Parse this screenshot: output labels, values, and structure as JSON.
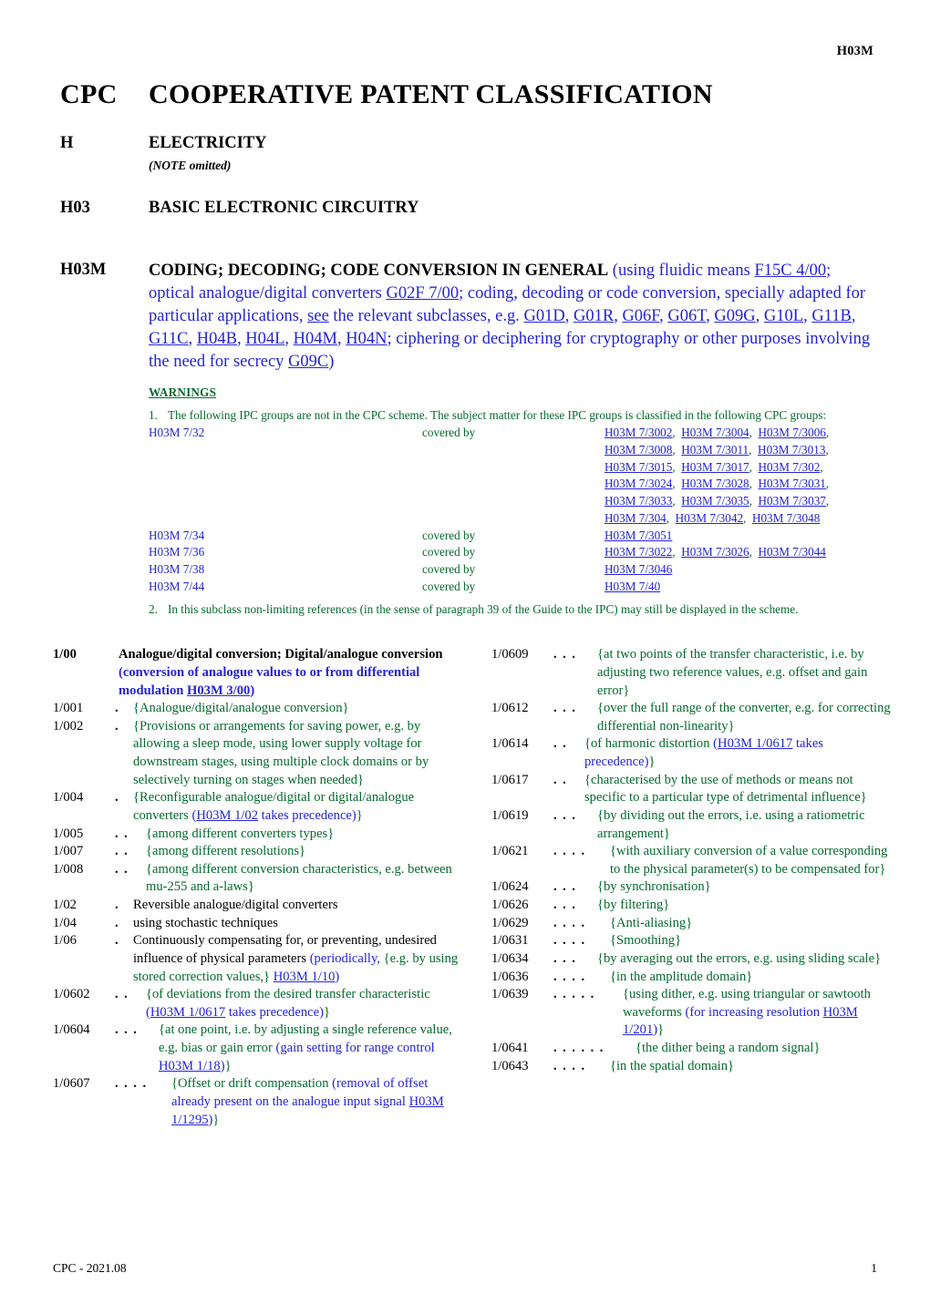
{
  "header": {
    "running_head": "H03M"
  },
  "titles": {
    "cpc_code": "CPC",
    "cpc_title": "COOPERATIVE PATENT CLASSIFICATION",
    "section_code": "H",
    "section_title": "ELECTRICITY",
    "note_omitted": "(NOTE omitted)",
    "class_code": "H03",
    "class_title": "BASIC ELECTRONIC CIRCUITRY"
  },
  "subclass": {
    "code": "H03M",
    "title": "CODING; DECODING; CODE CONVERSION IN GENERAL",
    "note_parts": [
      {
        "t": " (using fluidic means ",
        "style": "blue"
      },
      {
        "t": "F15C 4/00",
        "style": "link"
      },
      {
        "t": "; optical analogue/digital converters ",
        "style": "blue"
      },
      {
        "t": "G02F 7/00",
        "style": "link"
      },
      {
        "t": "; coding, decoding or code conversion, specially adapted for particular applications, ",
        "style": "blue"
      },
      {
        "t": "see",
        "style": "link"
      },
      {
        "t": " the relevant subclasses, e.g. ",
        "style": "blue"
      },
      {
        "t": "G01D",
        "style": "link"
      },
      {
        "t": ", ",
        "style": "blue"
      },
      {
        "t": "G01R",
        "style": "link"
      },
      {
        "t": ", ",
        "style": "blue"
      },
      {
        "t": "G06F",
        "style": "link"
      },
      {
        "t": ", ",
        "style": "blue"
      },
      {
        "t": "G06T",
        "style": "link"
      },
      {
        "t": ", ",
        "style": "blue"
      },
      {
        "t": "G09G",
        "style": "link"
      },
      {
        "t": ", ",
        "style": "blue"
      },
      {
        "t": "G10L",
        "style": "link"
      },
      {
        "t": ", ",
        "style": "blue"
      },
      {
        "t": "G11B",
        "style": "link"
      },
      {
        "t": ", ",
        "style": "blue"
      },
      {
        "t": "G11C",
        "style": "link"
      },
      {
        "t": ", ",
        "style": "blue"
      },
      {
        "t": "H04B",
        "style": "link"
      },
      {
        "t": ", ",
        "style": "blue"
      },
      {
        "t": "H04L",
        "style": "link"
      },
      {
        "t": ", ",
        "style": "blue"
      },
      {
        "t": "H04M",
        "style": "link"
      },
      {
        "t": ", ",
        "style": "blue"
      },
      {
        "t": "H04N",
        "style": "link"
      },
      {
        "t": "; ciphering or deciphering for cryptography or other purposes involving the need for secrecy ",
        "style": "blue"
      },
      {
        "t": "G09C",
        "style": "link"
      },
      {
        "t": ")",
        "style": "blue"
      }
    ]
  },
  "warnings": {
    "heading": "WARNINGS",
    "item1_number": "1.",
    "item1_text": "The following IPC groups are not in the CPC scheme. The subject matter for these IPC groups is classified in the following CPC groups:",
    "covered_by_label": "covered by",
    "rows": [
      {
        "ipc": "H03M 7/32",
        "covered": "covered by",
        "targets": [
          [
            "H03M 7/3002",
            "H03M 7/3004",
            "H03M 7/3006"
          ],
          [
            "H03M 7/3008",
            "H03M 7/3011",
            "H03M 7/3013"
          ],
          [
            "H03M 7/3015",
            "H03M 7/3017",
            "H03M 7/302"
          ],
          [
            "H03M 7/3024",
            "H03M 7/3028",
            "H03M 7/3031"
          ],
          [
            "H03M 7/3033",
            "H03M 7/3035",
            "H03M 7/3037"
          ],
          [
            "H03M 7/304",
            "H03M 7/3042",
            "H03M 7/3048"
          ]
        ]
      },
      {
        "ipc": "H03M 7/34",
        "covered": "covered by",
        "targets": [
          [
            "H03M 7/3051"
          ]
        ]
      },
      {
        "ipc": "H03M 7/36",
        "covered": "covered by",
        "targets": [
          [
            "H03M 7/3022",
            "H03M 7/3026",
            "H03M 7/3044"
          ]
        ]
      },
      {
        "ipc": "H03M 7/38",
        "covered": "covered by",
        "targets": [
          [
            "H03M 7/3046"
          ]
        ]
      },
      {
        "ipc": "H03M 7/44",
        "covered": "covered by",
        "targets": [
          [
            "H03M 7/40"
          ]
        ]
      }
    ],
    "item2_number": "2.",
    "item2_text": "In this subclass non-limiting references (in the sense of paragraph 39 of the Guide to the IPC) may still be displayed in the scheme."
  },
  "scheme": {
    "left_column": [
      {
        "symbol": "1/00",
        "dots": 0,
        "bold": true,
        "parts": [
          {
            "t": "Analogue/digital conversion; Digital/analogue conversion",
            "style": "boldblack"
          },
          {
            "t": " (conversion of analogue values to or from differential modulation ",
            "style": "blue"
          },
          {
            "t": "H03M 3/00",
            "style": "link"
          },
          {
            "t": ")",
            "style": "blue"
          }
        ]
      },
      {
        "symbol": "1/001",
        "dots": 1,
        "bold": false,
        "parts": [
          {
            "t": "{Analogue/digital/analogue conversion}",
            "style": "green"
          }
        ]
      },
      {
        "symbol": "1/002",
        "dots": 1,
        "bold": false,
        "parts": [
          {
            "t": "{Provisions or arrangements for saving power, e.g. by allowing a sleep mode, using lower supply voltage for downstream stages, using multiple clock domains or by selectively turning on stages when needed}",
            "style": "green"
          }
        ]
      },
      {
        "symbol": "1/004",
        "dots": 1,
        "bold": false,
        "parts": [
          {
            "t": "{Reconfigurable analogue/digital or digital/analogue converters ",
            "style": "green"
          },
          {
            "t": "(",
            "style": "blue"
          },
          {
            "t": "H03M 1/02",
            "style": "link"
          },
          {
            "t": " takes precedence)",
            "style": "blue"
          },
          {
            "t": "}",
            "style": "green"
          }
        ]
      },
      {
        "symbol": "1/005",
        "dots": 2,
        "bold": false,
        "parts": [
          {
            "t": "{among different converters types}",
            "style": "green"
          }
        ]
      },
      {
        "symbol": "1/007",
        "dots": 2,
        "bold": false,
        "parts": [
          {
            "t": "{among different resolutions}",
            "style": "green"
          }
        ]
      },
      {
        "symbol": "1/008",
        "dots": 2,
        "bold": false,
        "parts": [
          {
            "t": "{among different conversion characteristics, e.g. between mu-255 and a-laws}",
            "style": "green"
          }
        ]
      },
      {
        "symbol": "1/02",
        "dots": 1,
        "bold": false,
        "parts": [
          {
            "t": "Reversible analogue/digital converters",
            "style": "black"
          }
        ]
      },
      {
        "symbol": "1/04",
        "dots": 1,
        "bold": false,
        "parts": [
          {
            "t": "using stochastic techniques",
            "style": "black"
          }
        ]
      },
      {
        "symbol": "1/06",
        "dots": 1,
        "bold": false,
        "parts": [
          {
            "t": "Continuously compensating for, or preventing, undesired influence of physical parameters",
            "style": "black"
          },
          {
            "t": " (periodically, ",
            "style": "blue"
          },
          {
            "t": "{e.g. by using stored correction values,}",
            "style": "green"
          },
          {
            "t": " ",
            "style": "blue"
          },
          {
            "t": "H03M 1/10",
            "style": "link"
          },
          {
            "t": ")",
            "style": "blue"
          }
        ]
      },
      {
        "symbol": "1/0602",
        "dots": 2,
        "bold": false,
        "parts": [
          {
            "t": "{of deviations from the desired transfer characteristic ",
            "style": "green"
          },
          {
            "t": "(",
            "style": "blue"
          },
          {
            "t": "H03M 1/0617",
            "style": "link"
          },
          {
            "t": " takes precedence)",
            "style": "blue"
          },
          {
            "t": "}",
            "style": "green"
          }
        ]
      },
      {
        "symbol": "1/0604",
        "dots": 3,
        "bold": false,
        "parts": [
          {
            "t": "{at one point, i.e. by adjusting a single reference value, e.g. bias or gain error ",
            "style": "green"
          },
          {
            "t": "(gain setting for range control ",
            "style": "blue"
          },
          {
            "t": "H03M 1/18",
            "style": "link"
          },
          {
            "t": ")",
            "style": "blue"
          },
          {
            "t": "}",
            "style": "green"
          }
        ]
      },
      {
        "symbol": "1/0607",
        "dots": 4,
        "bold": false,
        "parts": [
          {
            "t": "{Offset or drift compensation ",
            "style": "green"
          },
          {
            "t": "(removal of offset already present on the analogue input signal ",
            "style": "blue"
          },
          {
            "t": "H03M 1/1295",
            "style": "link"
          },
          {
            "t": ")",
            "style": "blue"
          },
          {
            "t": "}",
            "style": "green"
          }
        ]
      }
    ],
    "right_column": [
      {
        "symbol": "1/0609",
        "dots": 3,
        "bold": false,
        "parts": [
          {
            "t": "{at two points of the transfer characteristic, i.e. by adjusting two reference values, e.g. offset and gain error}",
            "style": "green"
          }
        ]
      },
      {
        "symbol": "1/0612",
        "dots": 3,
        "bold": false,
        "parts": [
          {
            "t": "{over the full range of the converter, e.g. for correcting differential non-linearity}",
            "style": "green"
          }
        ]
      },
      {
        "symbol": "1/0614",
        "dots": 2,
        "bold": false,
        "parts": [
          {
            "t": "{of harmonic distortion ",
            "style": "green"
          },
          {
            "t": "(",
            "style": "blue"
          },
          {
            "t": "H03M 1/0617",
            "style": "link"
          },
          {
            "t": " takes precedence)",
            "style": "blue"
          },
          {
            "t": "}",
            "style": "green"
          }
        ]
      },
      {
        "symbol": "1/0617",
        "dots": 2,
        "bold": false,
        "parts": [
          {
            "t": "{characterised by the use of methods or means not specific to a particular type of detrimental influence}",
            "style": "green"
          }
        ]
      },
      {
        "symbol": "1/0619",
        "dots": 3,
        "bold": false,
        "parts": [
          {
            "t": "{by dividing out the errors, i.e. using a ratiometric arrangement}",
            "style": "green"
          }
        ]
      },
      {
        "symbol": "1/0621",
        "dots": 4,
        "bold": false,
        "parts": [
          {
            "t": "{with auxiliary conversion of a value corresponding to the physical parameter(s) to be compensated for}",
            "style": "green"
          }
        ]
      },
      {
        "symbol": "1/0624",
        "dots": 3,
        "bold": false,
        "parts": [
          {
            "t": "{by synchronisation}",
            "style": "green"
          }
        ]
      },
      {
        "symbol": "1/0626",
        "dots": 3,
        "bold": false,
        "parts": [
          {
            "t": "{by filtering}",
            "style": "green"
          }
        ]
      },
      {
        "symbol": "1/0629",
        "dots": 4,
        "bold": false,
        "parts": [
          {
            "t": "{Anti-aliasing}",
            "style": "green"
          }
        ]
      },
      {
        "symbol": "1/0631",
        "dots": 4,
        "bold": false,
        "parts": [
          {
            "t": "{Smoothing}",
            "style": "green"
          }
        ]
      },
      {
        "symbol": "1/0634",
        "dots": 3,
        "bold": false,
        "parts": [
          {
            "t": "{by averaging out the errors, e.g. using sliding scale}",
            "style": "green"
          }
        ]
      },
      {
        "symbol": "1/0636",
        "dots": 4,
        "bold": false,
        "parts": [
          {
            "t": "{in the amplitude domain}",
            "style": "green"
          }
        ]
      },
      {
        "symbol": "1/0639",
        "dots": 5,
        "bold": false,
        "parts": [
          {
            "t": "{using dither, e.g. using triangular or sawtooth waveforms ",
            "style": "green"
          },
          {
            "t": "(for increasing resolution ",
            "style": "blue"
          },
          {
            "t": "H03M 1/201",
            "style": "link"
          },
          {
            "t": ")",
            "style": "blue"
          },
          {
            "t": "}",
            "style": "green"
          }
        ]
      },
      {
        "symbol": "1/0641",
        "dots": 6,
        "bold": false,
        "parts": [
          {
            "t": "{the dither being a random signal}",
            "style": "green"
          }
        ]
      },
      {
        "symbol": "1/0643",
        "dots": 4,
        "bold": false,
        "parts": [
          {
            "t": "{in the spatial domain}",
            "style": "green"
          }
        ]
      }
    ]
  },
  "footer": {
    "left": "CPC - 2021.08",
    "page_number": "1"
  }
}
